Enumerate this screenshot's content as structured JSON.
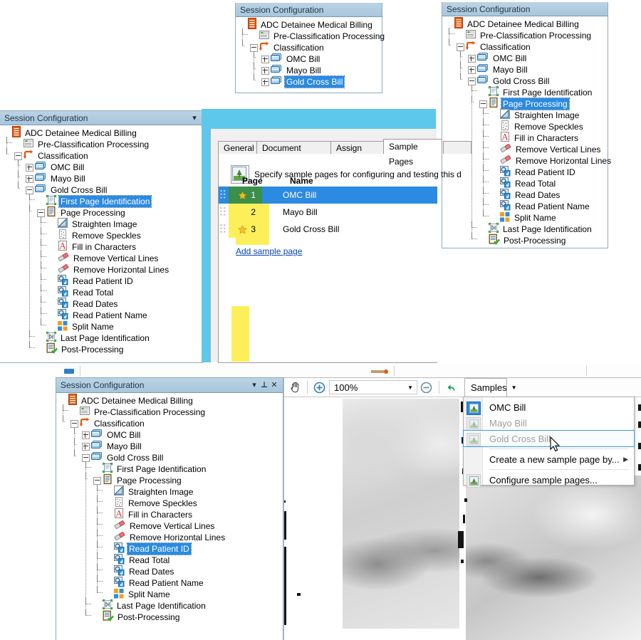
{
  "panels": {
    "session_configuration_title": "Session Configuration"
  },
  "tree_top_small": {
    "title": "Session Configuration",
    "nodes": [
      {
        "label": "ADC Detainee Medical Billing",
        "icon": "document-icon",
        "depth": 0,
        "toggle": "none",
        "selected": false
      },
      {
        "label": "Pre-Classification Processing",
        "icon": "preclass-icon",
        "depth": 1,
        "toggle": "none",
        "selected": false
      },
      {
        "label": "Classification",
        "icon": "classification-icon",
        "depth": 1,
        "toggle": "minus",
        "selected": false
      },
      {
        "label": "OMC Bill",
        "icon": "document-class-icon",
        "depth": 2,
        "toggle": "plus",
        "selected": false
      },
      {
        "label": "Mayo Bill",
        "icon": "document-class-icon",
        "depth": 2,
        "toggle": "plus",
        "selected": false
      },
      {
        "label": "Gold Cross Bill",
        "icon": "document-class-icon",
        "depth": 2,
        "toggle": "plus",
        "selected": true
      }
    ]
  },
  "tree_top_right": {
    "title": "Session Configuration",
    "nodes": [
      {
        "label": "ADC Detainee Medical Billing",
        "icon": "document-icon",
        "depth": 0,
        "toggle": "none",
        "selected": false
      },
      {
        "label": "Pre-Classification Processing",
        "icon": "preclass-icon",
        "depth": 1,
        "toggle": "none",
        "selected": false
      },
      {
        "label": "Classification",
        "icon": "classification-icon",
        "depth": 1,
        "toggle": "minus",
        "selected": false
      },
      {
        "label": "OMC Bill",
        "icon": "document-class-icon",
        "depth": 2,
        "toggle": "plus",
        "selected": false
      },
      {
        "label": "Mayo Bill",
        "icon": "document-class-icon",
        "depth": 2,
        "toggle": "plus",
        "selected": false
      },
      {
        "label": "Gold Cross Bill",
        "icon": "document-class-icon",
        "depth": 2,
        "toggle": "minus",
        "selected": false
      },
      {
        "label": "First Page Identification",
        "icon": "first-page-icon",
        "depth": 3,
        "toggle": "none",
        "selected": false
      },
      {
        "label": "Page Processing",
        "icon": "page-processing-icon",
        "depth": 3,
        "toggle": "minus",
        "selected": true
      },
      {
        "label": "Straighten Image",
        "icon": "straighten-icon",
        "depth": 4,
        "toggle": "none",
        "selected": false
      },
      {
        "label": "Remove Speckles",
        "icon": "speckles-icon",
        "depth": 4,
        "toggle": "none",
        "selected": false
      },
      {
        "label": "Fill in Characters",
        "icon": "fill-characters-icon",
        "depth": 4,
        "toggle": "none",
        "selected": false
      },
      {
        "label": "Remove Vertical Lines",
        "icon": "eraser-icon",
        "depth": 4,
        "toggle": "none",
        "selected": false
      },
      {
        "label": "Remove Horizontal Lines",
        "icon": "eraser-icon",
        "depth": 4,
        "toggle": "none",
        "selected": false
      },
      {
        "label": "Read Patient ID",
        "icon": "read-icon",
        "depth": 4,
        "toggle": "none",
        "selected": false
      },
      {
        "label": "Read Total",
        "icon": "read-icon",
        "depth": 4,
        "toggle": "none",
        "selected": false
      },
      {
        "label": "Read Dates",
        "icon": "read-icon",
        "depth": 4,
        "toggle": "none",
        "selected": false
      },
      {
        "label": "Read Patient Name",
        "icon": "read-icon",
        "depth": 4,
        "toggle": "none",
        "selected": false
      },
      {
        "label": "Split Name",
        "icon": "split-icon",
        "depth": 4,
        "toggle": "none",
        "selected": false
      },
      {
        "label": "Last Page Identification",
        "icon": "last-page-icon",
        "depth": 3,
        "toggle": "none",
        "selected": false
      },
      {
        "label": "Post-Processing",
        "icon": "post-processing-icon",
        "depth": 3,
        "toggle": "none",
        "selected": false
      }
    ]
  },
  "tree_mid_left": {
    "title": "Session Configuration",
    "nodes": [
      {
        "label": "ADC Detainee Medical Billing",
        "icon": "document-icon",
        "depth": 0,
        "toggle": "none",
        "selected": false
      },
      {
        "label": "Pre-Classification Processing",
        "icon": "preclass-icon",
        "depth": 1,
        "toggle": "none",
        "selected": false
      },
      {
        "label": "Classification",
        "icon": "classification-icon",
        "depth": 1,
        "toggle": "minus",
        "selected": false
      },
      {
        "label": "OMC Bill",
        "icon": "document-class-icon",
        "depth": 2,
        "toggle": "plus",
        "selected": false
      },
      {
        "label": "Mayo Bill",
        "icon": "document-class-icon",
        "depth": 2,
        "toggle": "plus",
        "selected": false
      },
      {
        "label": "Gold Cross Bill",
        "icon": "document-class-icon",
        "depth": 2,
        "toggle": "minus",
        "selected": false
      },
      {
        "label": "First Page Identification",
        "icon": "first-page-icon",
        "depth": 3,
        "toggle": "none",
        "selected": true
      },
      {
        "label": "Page Processing",
        "icon": "page-processing-icon",
        "depth": 3,
        "toggle": "minus",
        "selected": false
      },
      {
        "label": "Straighten Image",
        "icon": "straighten-icon",
        "depth": 4,
        "toggle": "none",
        "selected": false
      },
      {
        "label": "Remove Speckles",
        "icon": "speckles-icon",
        "depth": 4,
        "toggle": "none",
        "selected": false
      },
      {
        "label": "Fill in Characters",
        "icon": "fill-characters-icon",
        "depth": 4,
        "toggle": "none",
        "selected": false
      },
      {
        "label": "Remove Vertical Lines",
        "icon": "eraser-icon",
        "depth": 4,
        "toggle": "none",
        "selected": false
      },
      {
        "label": "Remove Horizontal Lines",
        "icon": "eraser-icon",
        "depth": 4,
        "toggle": "none",
        "selected": false
      },
      {
        "label": "Read Patient ID",
        "icon": "read-icon",
        "depth": 4,
        "toggle": "none",
        "selected": false
      },
      {
        "label": "Read Total",
        "icon": "read-icon",
        "depth": 4,
        "toggle": "none",
        "selected": false
      },
      {
        "label": "Read Dates",
        "icon": "read-icon",
        "depth": 4,
        "toggle": "none",
        "selected": false
      },
      {
        "label": "Read Patient Name",
        "icon": "read-icon",
        "depth": 4,
        "toggle": "none",
        "selected": false
      },
      {
        "label": "Split Name",
        "icon": "split-icon",
        "depth": 4,
        "toggle": "none",
        "selected": false
      },
      {
        "label": "Last Page Identification",
        "icon": "last-page-icon",
        "depth": 3,
        "toggle": "none",
        "selected": false
      },
      {
        "label": "Post-Processing",
        "icon": "post-processing-icon",
        "depth": 3,
        "toggle": "none",
        "selected": false
      }
    ]
  },
  "tree_bottom": {
    "title": "Session Configuration",
    "header_buttons": [
      "dropdown-arrow-icon",
      "pin-icon",
      "close-icon"
    ],
    "nodes": [
      {
        "label": "ADC Detainee Medical Billing",
        "icon": "document-icon",
        "depth": 0,
        "toggle": "none",
        "selected": false
      },
      {
        "label": "Pre-Classification Processing",
        "icon": "preclass-icon",
        "depth": 1,
        "toggle": "none",
        "selected": false
      },
      {
        "label": "Classification",
        "icon": "classification-icon",
        "depth": 1,
        "toggle": "minus",
        "selected": false
      },
      {
        "label": "OMC Bill",
        "icon": "document-class-icon",
        "depth": 2,
        "toggle": "plus",
        "selected": false
      },
      {
        "label": "Mayo Bill",
        "icon": "document-class-icon",
        "depth": 2,
        "toggle": "plus",
        "selected": false
      },
      {
        "label": "Gold Cross Bill",
        "icon": "document-class-icon",
        "depth": 2,
        "toggle": "minus",
        "selected": false
      },
      {
        "label": "First Page Identification",
        "icon": "first-page-icon",
        "depth": 3,
        "toggle": "none",
        "selected": false
      },
      {
        "label": "Page Processing",
        "icon": "page-processing-icon",
        "depth": 3,
        "toggle": "minus",
        "selected": false
      },
      {
        "label": "Straighten Image",
        "icon": "straighten-icon",
        "depth": 4,
        "toggle": "none",
        "selected": false
      },
      {
        "label": "Remove Speckles",
        "icon": "speckles-icon",
        "depth": 4,
        "toggle": "none",
        "selected": false
      },
      {
        "label": "Fill in Characters",
        "icon": "fill-characters-icon",
        "depth": 4,
        "toggle": "none",
        "selected": false
      },
      {
        "label": "Remove Vertical Lines",
        "icon": "eraser-icon",
        "depth": 4,
        "toggle": "none",
        "selected": false
      },
      {
        "label": "Remove Horizontal Lines",
        "icon": "eraser-icon",
        "depth": 4,
        "toggle": "none",
        "selected": false
      },
      {
        "label": "Read Patient ID",
        "icon": "read-icon",
        "depth": 4,
        "toggle": "none",
        "selected": true
      },
      {
        "label": "Read Total",
        "icon": "read-icon",
        "depth": 4,
        "toggle": "none",
        "selected": false
      },
      {
        "label": "Read Dates",
        "icon": "read-icon",
        "depth": 4,
        "toggle": "none",
        "selected": false
      },
      {
        "label": "Read Patient Name",
        "icon": "read-icon",
        "depth": 4,
        "toggle": "none",
        "selected": false
      },
      {
        "label": "Split Name",
        "icon": "split-icon",
        "depth": 4,
        "toggle": "none",
        "selected": false
      },
      {
        "label": "Last Page Identification",
        "icon": "last-page-icon",
        "depth": 3,
        "toggle": "none",
        "selected": false
      },
      {
        "label": "Post-Processing",
        "icon": "post-processing-icon",
        "depth": 3,
        "toggle": "none",
        "selected": false
      }
    ]
  },
  "dialog": {
    "tabs": [
      {
        "label": "General",
        "active": false
      },
      {
        "label": "Document Storage",
        "active": false
      },
      {
        "label": "Assign Tags",
        "active": false
      },
      {
        "label": "Sample Pages",
        "active": true
      }
    ],
    "instruction": "Specify sample pages for configuring and testing this d",
    "instruction_icon": "sample-page-icon",
    "columns": [
      "Page",
      "Name"
    ],
    "rows": [
      {
        "page": "1",
        "name": "OMC Bill",
        "star": true,
        "selected": true,
        "page_cell_color": "#3a8f4a"
      },
      {
        "page": "2",
        "name": "Mayo Bill",
        "star": false,
        "selected": false,
        "page_cell_color": "#fdef5a"
      },
      {
        "page": "3",
        "name": "Gold Cross Bill",
        "star": true,
        "selected": false,
        "page_cell_color": "#fdef5a"
      }
    ],
    "add_link": "Add sample page",
    "colors": {
      "selection": "#2b8ae2",
      "highlight_yellow": "#fdef5a",
      "title_bar": "#5dc8ec"
    }
  },
  "viewer": {
    "toolbar": {
      "pan_icon": "hand-icon",
      "zoom_in_icon": "zoom-in-icon",
      "zoom_out_icon": "zoom-out-icon",
      "undo_icon": "undo-icon",
      "redo_icon": "redo-icon",
      "zoom_value": "100%",
      "zoom_dropdown_icon": "chevron-down-icon",
      "samples_label": "Samples",
      "samples_caret_icon": "chevron-down-icon"
    },
    "samples_menu": {
      "items": [
        {
          "label": "OMC Bill",
          "icon": "sample-page-icon",
          "disabled": false,
          "hover": false,
          "icon_selected": true,
          "submenu": false
        },
        {
          "label": "Mayo Bill",
          "icon": "sample-page-icon",
          "disabled": true,
          "hover": false,
          "icon_selected": false,
          "submenu": false
        },
        {
          "label": "Gold Cross Bill",
          "icon": "sample-page-icon",
          "disabled": true,
          "hover": true,
          "icon_selected": false,
          "submenu": false
        },
        {
          "separator": true
        },
        {
          "label": "Create a new sample page by...",
          "icon": "none",
          "disabled": false,
          "hover": false,
          "icon_selected": false,
          "submenu": true
        },
        {
          "separator": true
        },
        {
          "label": "Configure sample pages...",
          "icon": "sample-page-icon",
          "disabled": false,
          "hover": false,
          "icon_selected": false,
          "submenu": false
        }
      ]
    },
    "cursor": "mouse-pointer"
  }
}
